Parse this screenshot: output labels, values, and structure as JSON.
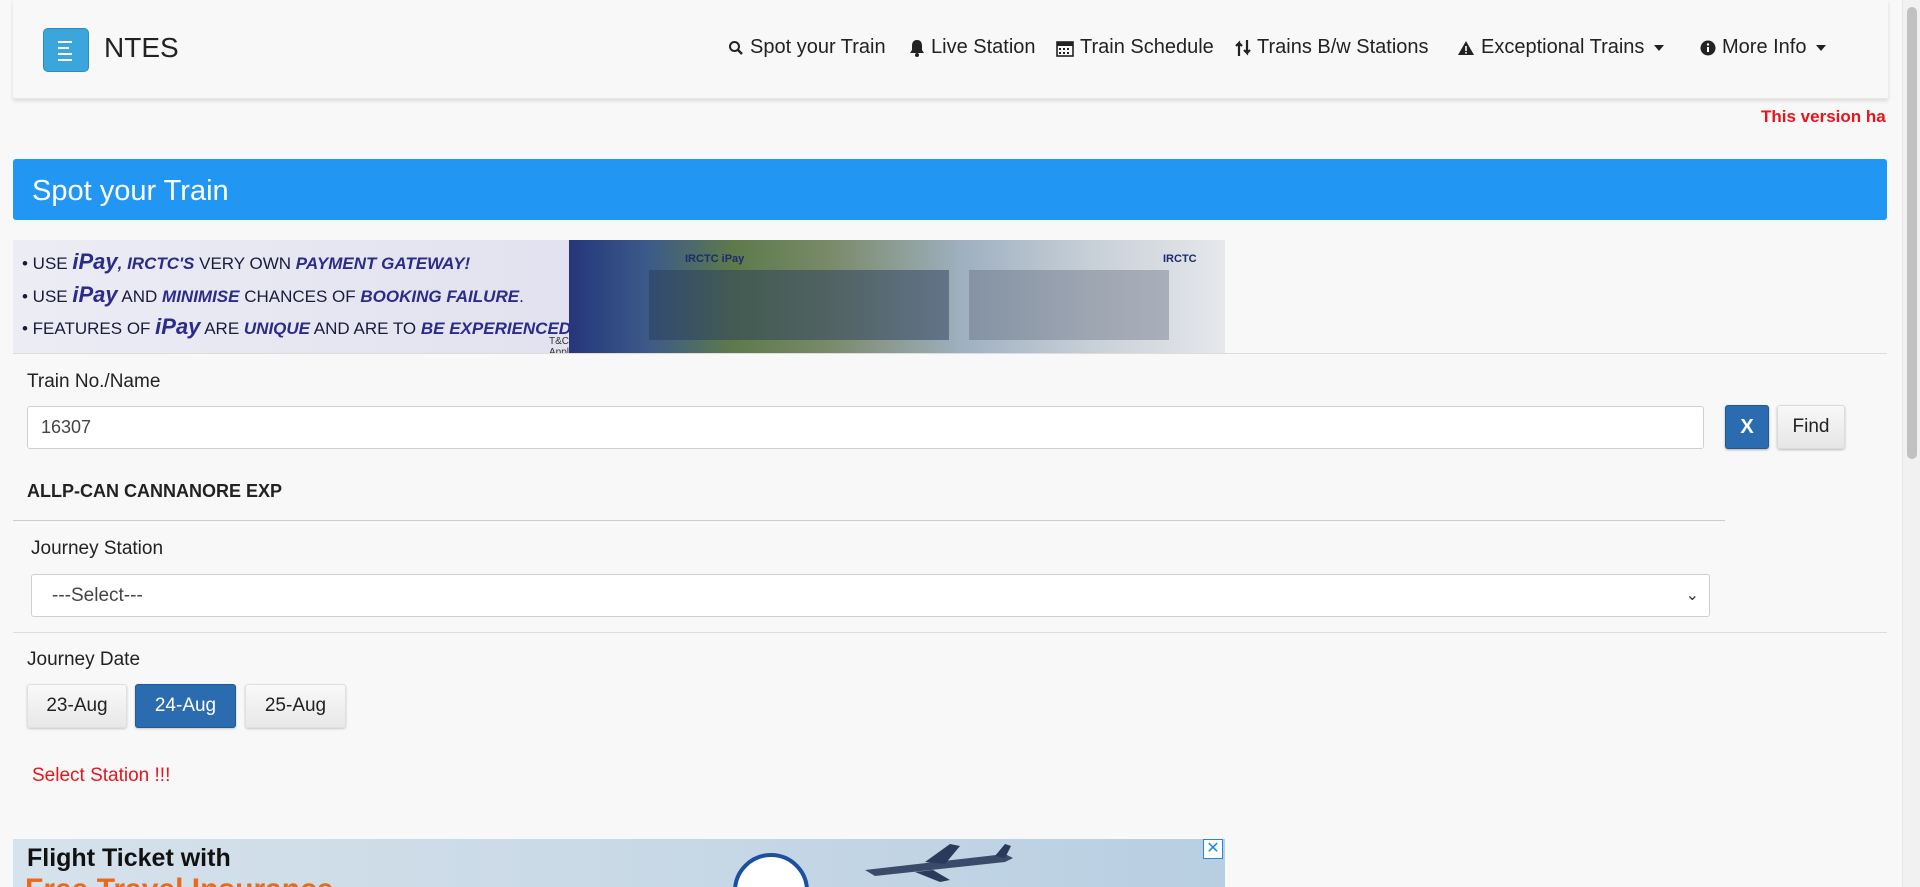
{
  "navbar": {
    "brand": "NTES",
    "items": [
      {
        "label": "Spot your Train",
        "icon": "search-icon"
      },
      {
        "label": "Live Station",
        "icon": "bell-icon"
      },
      {
        "label": "Train Schedule",
        "icon": "calendar-icon"
      },
      {
        "label": "Trains B/w Stations",
        "icon": "sort-icon"
      },
      {
        "label": "Exceptional Trains",
        "icon": "warning-icon"
      },
      {
        "label": "More Info",
        "icon": "info-icon"
      }
    ]
  },
  "marquee": "This version ha",
  "page_title": "Spot your Train",
  "banner": {
    "line1_a": "• USE ",
    "line1_b": "iPay",
    "line1_c": ", IRCTC'S",
    "line1_d": " VERY OWN ",
    "line1_e": "PAYMENT GATEWAY!",
    "line2_a": "• USE ",
    "line2_b": "iPay",
    "line2_c": " AND ",
    "line2_d": "MINIMISE",
    "line2_e": " CHANCES OF ",
    "line2_f": "BOOKING FAILURE",
    "line2_g": ".",
    "line3_a": "• FEATURES OF ",
    "line3_b": "iPay",
    "line3_c": " ARE ",
    "line3_d": "UNIQUE",
    "line3_e": " AND ARE TO ",
    "line3_f": "BE EXPERIENCED!",
    "tc": "T&C Apply",
    "brand1": "IRCTC iPay",
    "brand2": "IRCTC"
  },
  "form": {
    "train_label": "Train No./Name",
    "train_value": "16307",
    "clear_label": "X",
    "find_label": "Find",
    "train_name": "ALLP-CAN CANNANORE EXP",
    "station_label": "Journey Station",
    "station_selected": "---Select---",
    "date_label": "Journey Date",
    "dates": [
      {
        "label": "23-Aug",
        "active": false
      },
      {
        "label": "24-Aug",
        "active": true
      },
      {
        "label": "25-Aug",
        "active": false
      }
    ],
    "error": "Select Station !!!"
  },
  "ad": {
    "line1": "Flight Ticket with",
    "line2": "Free Travel Insurance",
    "close": "✕"
  },
  "colors": {
    "primary": "#2196f3",
    "button_active": "#2b6cb0",
    "error": "#e8141c",
    "brand_button": "#3aa6dc"
  }
}
